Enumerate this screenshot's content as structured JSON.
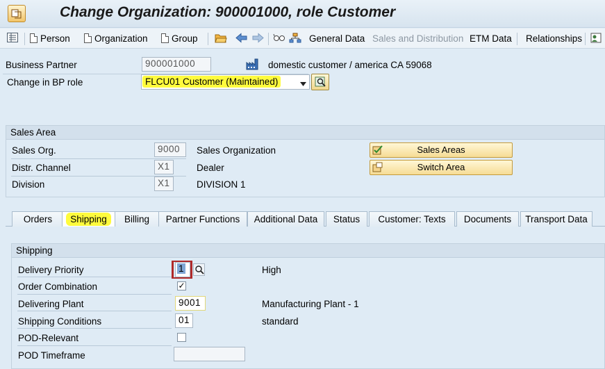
{
  "window": {
    "title": "Change Organization: 900001000, role Customer"
  },
  "toolbar": {
    "person": "Person",
    "organization": "Organization",
    "group": "Group",
    "general_data": "General Data",
    "sales_distribution": "Sales and Distribution",
    "etm_data": "ETM Data",
    "relationships": "Relationships"
  },
  "header": {
    "bp_label": "Business Partner",
    "bp_value": "900001000",
    "bp_desc": "domestic customer / america CA 59068",
    "role_label": "Change in BP role",
    "role_value": "FLCU01 Customer (Maintained)"
  },
  "sales_area": {
    "title": "Sales Area",
    "sales_org_label": "Sales Org.",
    "sales_org_value": "9000",
    "sales_org_desc": "Sales Organization",
    "distr_label": "Distr. Channel",
    "distr_value": "X1",
    "distr_desc": "Dealer",
    "division_label": "Division",
    "division_value": "X1",
    "division_desc": "DIVISION 1",
    "btn_sales_areas": "Sales Areas",
    "btn_switch_area": "Switch Area"
  },
  "tabs": [
    {
      "label": "Orders"
    },
    {
      "label": "Shipping"
    },
    {
      "label": "Billing"
    },
    {
      "label": "Partner Functions"
    },
    {
      "label": "Additional Data"
    },
    {
      "label": "Status"
    },
    {
      "label": "Customer: Texts"
    },
    {
      "label": "Documents"
    },
    {
      "label": "Transport Data"
    }
  ],
  "shipping": {
    "title": "Shipping",
    "delivery_priority_label": "Delivery Priority",
    "delivery_priority_value": "1",
    "delivery_priority_desc": "High",
    "order_combination_label": "Order Combination",
    "order_combination_checked": "✓",
    "delivering_plant_label": "Delivering Plant",
    "delivering_plant_value": "9001",
    "delivering_plant_desc": "Manufacturing Plant - 1",
    "shipping_conditions_label": "Shipping Conditions",
    "shipping_conditions_value": "01",
    "shipping_conditions_desc": "standard",
    "pod_relevant_label": "POD-Relevant",
    "pod_timeframe_label": "POD Timeframe",
    "pod_timeframe_value": ""
  },
  "colors": {
    "highlight": "#fffb3d",
    "background": "#dfebf5"
  }
}
